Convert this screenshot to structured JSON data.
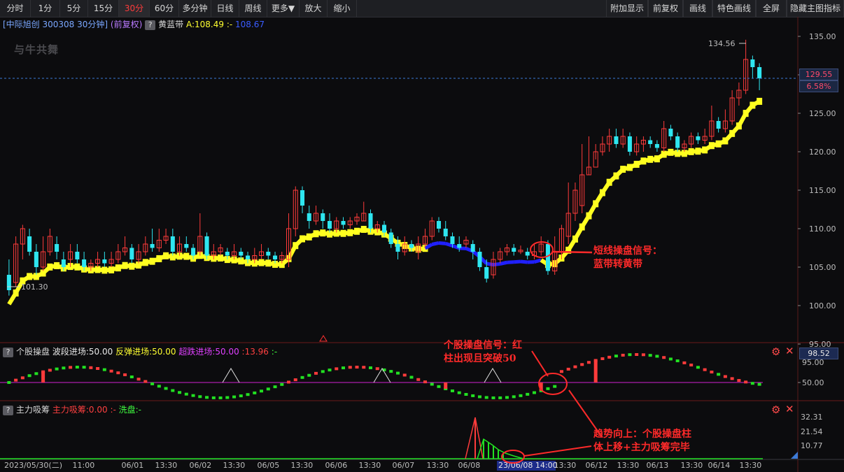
{
  "toolbar": {
    "left_items": [
      "分时",
      "1分",
      "5分",
      "15分",
      "30分",
      "60分",
      "多分钟",
      "日线",
      "周线",
      "更多▼",
      "放大",
      "缩小"
    ],
    "active_item": "30分",
    "right_items": [
      "附加显示",
      "前复权",
      "画线",
      "特色画线",
      "全屏",
      "隐藏主图指标"
    ]
  },
  "main_panel": {
    "stock_title": "[中际旭创 300308 30分钟]",
    "adjust_mode": "(前复权)",
    "help_glyph": "?",
    "indicator_name": "黄蓝带",
    "indicator_value_a": "A:108.49",
    "indicator_sep": ":-",
    "indicator_value_b": "108.67",
    "logo_text": "与牛共舞",
    "high_label": "134.56",
    "low_label": "101.30",
    "current_price": "129.55",
    "current_pct": "6.58%",
    "price_axis": [
      "135.00",
      "130.00",
      "125.00",
      "120.00",
      "115.00",
      "110.00",
      "105.00",
      "100.00",
      "95.00"
    ]
  },
  "panel2": {
    "name": "个股操盘",
    "line1": "波段进场:50.00",
    "line2": "反弹进场:50.00",
    "line3": "超跌进场:50.00",
    "line4": ":13.96",
    "line5": ":-",
    "value_tag": "98.52",
    "axis": [
      "95.00",
      "50.00"
    ]
  },
  "panel3": {
    "name": "主力吸筹",
    "line1": "主力吸筹:0.00",
    "line2": ":-",
    "line3": "洗盘:-",
    "axis": [
      "32.31",
      "21.54",
      "10.77"
    ]
  },
  "time_axis": {
    "first": "2023/05/30(二)",
    "labels": [
      "11:00",
      "06/01",
      "13:30",
      "06/02",
      "13:30",
      "06/05",
      "13:30",
      "06/06",
      "13:30",
      "06/07",
      "13:30",
      "06/08",
      "13:30",
      "06/12",
      "13:30",
      "06/13",
      "13:30",
      "06/14",
      "13:30"
    ],
    "cursor": "23/06/08 14:00"
  },
  "annotations": {
    "ann1": [
      "短线操盘信号：",
      "蓝带转黄带"
    ],
    "ann2": [
      "个股操盘信号：红",
      "柱出现且突破50"
    ],
    "ann3": [
      "趋势向上：个股操盘柱",
      "体上移+主力吸筹完毕"
    ]
  },
  "colors": {
    "up": "#ff3b3b",
    "down": "#2ee6f0",
    "yellow_band": "#ffff20",
    "blue_band": "#2020ff",
    "magenta_line": "#d020d0",
    "green": "#22e022",
    "annotation": "#ff2a2a"
  },
  "chart_data": {
    "type": "candlestick",
    "ylim": [
      95,
      135
    ],
    "candles": [
      [
        104,
        102,
        106,
        101.3
      ],
      [
        103,
        108,
        109,
        102.5
      ],
      [
        108,
        110,
        110.5,
        106
      ],
      [
        109,
        107,
        110,
        106.5
      ],
      [
        107,
        105,
        108,
        104
      ],
      [
        105,
        107,
        109,
        104.5
      ],
      [
        107,
        109,
        110,
        106.5
      ],
      [
        108,
        107,
        109,
        106
      ],
      [
        106,
        105,
        107,
        104.5
      ],
      [
        106,
        107,
        108,
        105
      ],
      [
        107,
        106,
        108,
        105.5
      ],
      [
        106,
        105,
        107,
        104.5
      ],
      [
        105,
        105.5,
        106,
        104.5
      ],
      [
        105.5,
        106,
        107,
        105
      ],
      [
        106,
        105.5,
        107,
        105
      ],
      [
        105.5,
        106,
        107,
        105
      ],
      [
        106,
        107,
        108,
        105.5
      ],
      [
        107,
        107.5,
        109,
        106.5
      ],
      [
        107.5,
        106,
        108,
        105.5
      ],
      [
        106,
        107,
        108,
        105.5
      ],
      [
        107,
        108,
        109,
        106.5
      ],
      [
        108,
        107.5,
        110,
        107
      ],
      [
        107.5,
        108.5,
        110,
        107
      ],
      [
        108.5,
        109,
        110,
        108
      ],
      [
        109,
        107,
        110,
        106.5
      ],
      [
        107,
        108,
        109,
        106.5
      ],
      [
        108,
        107.5,
        109,
        107
      ],
      [
        107.5,
        106.5,
        108,
        106
      ],
      [
        107,
        109,
        112,
        106.5
      ],
      [
        109,
        106.5,
        109.5,
        106
      ],
      [
        106.5,
        107,
        108,
        106
      ],
      [
        107,
        107.5,
        108,
        106.5
      ],
      [
        107,
        106.5,
        107.5,
        106
      ],
      [
        106.5,
        107,
        108,
        106
      ],
      [
        107,
        106.5,
        107.5,
        106
      ],
      [
        106.5,
        106,
        107,
        105.5
      ],
      [
        106,
        106.5,
        107.5,
        105.5
      ],
      [
        106.5,
        107,
        108,
        106
      ],
      [
        107,
        106.5,
        107.5,
        106
      ],
      [
        106.5,
        106,
        107,
        105.5
      ],
      [
        106,
        106.5,
        107,
        105.5
      ],
      [
        106,
        110,
        112,
        105
      ],
      [
        110,
        115,
        115.5,
        109
      ],
      [
        115,
        113,
        115.5,
        112
      ],
      [
        112,
        111,
        113,
        110
      ],
      [
        111,
        112,
        113,
        110.5
      ],
      [
        112,
        111,
        112.5,
        110
      ],
      [
        111,
        110,
        112,
        109.5
      ],
      [
        110,
        111,
        111.5,
        109.5
      ],
      [
        111,
        110.5,
        111.5,
        110
      ],
      [
        110.5,
        111,
        111.5,
        110
      ],
      [
        111,
        111.5,
        112,
        110.5
      ],
      [
        111,
        112,
        113.5,
        111
      ],
      [
        112,
        110,
        112.5,
        109.5
      ],
      [
        110,
        110.5,
        111,
        109.5
      ],
      [
        110.5,
        109.5,
        111,
        109
      ],
      [
        109.5,
        108,
        110,
        107.5
      ],
      [
        108,
        107,
        109,
        106
      ],
      [
        107,
        108,
        109,
        106.5
      ],
      [
        108,
        107.5,
        108.5,
        107
      ],
      [
        107,
        108,
        109,
        106
      ],
      [
        108,
        109,
        110,
        107.5
      ],
      [
        109,
        111,
        111.5,
        108.5
      ],
      [
        111,
        110,
        111.5,
        109.5
      ],
      [
        110,
        109,
        111,
        108.5
      ],
      [
        109,
        108,
        109.5,
        107.5
      ],
      [
        108,
        107.5,
        109,
        107
      ],
      [
        108,
        108.5,
        109,
        107.5
      ],
      [
        108,
        107,
        108.5,
        106
      ],
      [
        107,
        105,
        107.5,
        104.5
      ],
      [
        105,
        103.5,
        106,
        103
      ],
      [
        104,
        106,
        107,
        103.5
      ],
      [
        106,
        107,
        107.5,
        105.5
      ],
      [
        107,
        107.5,
        108,
        106.5
      ],
      [
        107.5,
        107,
        108,
        106.5
      ],
      [
        107,
        107.2,
        107.8,
        106.7
      ],
      [
        107,
        106.5,
        107.5,
        106
      ],
      [
        106.5,
        107,
        108,
        106
      ],
      [
        107,
        108,
        109,
        106.5
      ],
      [
        108,
        104.5,
        108.5,
        104
      ],
      [
        104.5,
        107,
        109,
        104
      ],
      [
        107,
        110,
        110.5,
        106
      ],
      [
        109,
        112,
        116,
        108
      ],
      [
        112,
        115,
        116,
        111
      ],
      [
        113,
        117,
        121,
        112
      ],
      [
        117,
        118,
        122,
        117
      ],
      [
        118,
        120,
        121,
        119
      ],
      [
        120,
        121,
        122,
        119.5
      ],
      [
        121,
        122,
        123,
        120
      ],
      [
        122,
        121,
        123,
        120.5
      ],
      [
        121,
        122,
        123,
        120.5
      ],
      [
        122,
        120,
        122.5,
        119.5
      ],
      [
        120,
        121,
        122,
        119.5
      ],
      [
        121,
        121.5,
        122,
        120
      ],
      [
        121.5,
        121,
        122,
        120.5
      ],
      [
        121,
        120.5,
        121.5,
        120
      ],
      [
        120.5,
        123,
        124,
        120
      ],
      [
        123,
        122,
        123.5,
        121.5
      ],
      [
        122,
        120.5,
        122.5,
        120
      ],
      [
        120.5,
        121,
        121.5,
        120
      ],
      [
        121,
        122,
        122.5,
        120.5
      ],
      [
        122,
        121.5,
        122.5,
        121
      ],
      [
        121.5,
        122,
        123,
        121
      ],
      [
        122,
        124,
        126,
        121.5
      ],
      [
        124,
        123,
        124.5,
        122.5
      ],
      [
        123,
        124,
        125.5,
        122.5
      ],
      [
        124,
        127,
        128,
        123.5
      ],
      [
        127,
        128,
        129,
        126
      ],
      [
        128,
        132,
        134.56,
        127.5
      ],
      [
        132,
        131,
        132.5,
        129.5
      ],
      [
        131,
        129.55,
        131.5,
        128
      ]
    ]
  }
}
